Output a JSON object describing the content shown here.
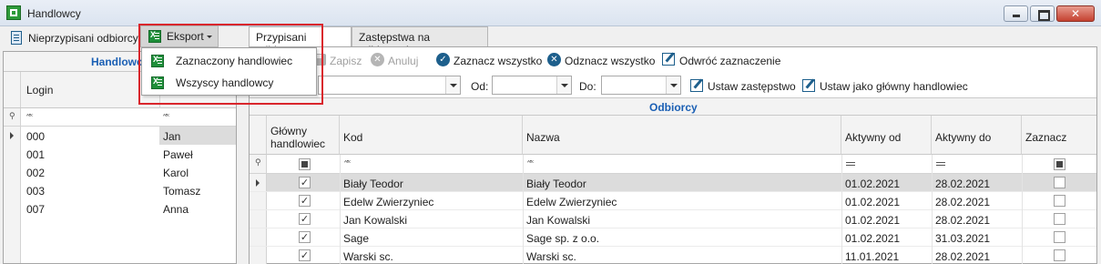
{
  "window": {
    "title": "Handlowcy"
  },
  "toolbar": {
    "unassigned_label": "Nieprzypisani odbiorcy",
    "export_label": "Eksport",
    "export_menu": [
      "Zaznaczony handlowiec",
      "Wszyscy handlowcy"
    ]
  },
  "left_panel": {
    "title": "Handlowcy",
    "columns": [
      "Login",
      ""
    ],
    "rows": [
      {
        "login": "000",
        "name": "Jan"
      },
      {
        "login": "001",
        "name": "Paweł"
      },
      {
        "login": "002",
        "name": "Karol"
      },
      {
        "login": "003",
        "name": "Tomasz"
      },
      {
        "login": "007",
        "name": "Anna"
      }
    ]
  },
  "tabs": [
    "Przypisani odbiorcy",
    "Zastępstwa na odbiorcach"
  ],
  "actions": {
    "save": "Zapisz",
    "cancel": "Anuluj",
    "check_all": "Zaznacz wszystko",
    "uncheck_all": "Odznacz wszystko",
    "invert": "Odwróć zaznaczenie",
    "from_label": "Od:",
    "to_label": "Do:",
    "set_substitute": "Ustaw zastępstwo",
    "set_main": "Ustaw jako główny handlowiec"
  },
  "grid": {
    "title": "Odbiorcy",
    "columns": {
      "main_line1": "Główny",
      "main_line2": "handlowiec",
      "code": "Kod",
      "name": "Nazwa",
      "active_from": "Aktywny od",
      "active_to": "Aktywny do",
      "select": "Zaznacz"
    },
    "rows": [
      {
        "main": true,
        "code": "Biały Teodor",
        "name": "Biały Teodor",
        "from": "01.02.2021",
        "to": "28.02.2021",
        "select": false
      },
      {
        "main": true,
        "code": "Edelw Zwierzyniec",
        "name": "Edelw Zwierzyniec",
        "from": "01.02.2021",
        "to": "28.02.2021",
        "select": false
      },
      {
        "main": true,
        "code": "Jan Kowalski",
        "name": "Jan Kowalski",
        "from": "01.02.2021",
        "to": "28.02.2021",
        "select": false
      },
      {
        "main": true,
        "code": "Sage",
        "name": "Sage sp. z o.o.",
        "from": "01.02.2021",
        "to": "31.03.2021",
        "select": false
      },
      {
        "main": true,
        "code": "Warski sc.",
        "name": "Warski sc.",
        "from": "11.01.2021",
        "to": "28.02.2021",
        "select": false
      }
    ]
  },
  "colors": {
    "accent_blue": "#1a5fb4",
    "highlight_red": "#d9262c",
    "excel_green": "#1f8f3a"
  }
}
